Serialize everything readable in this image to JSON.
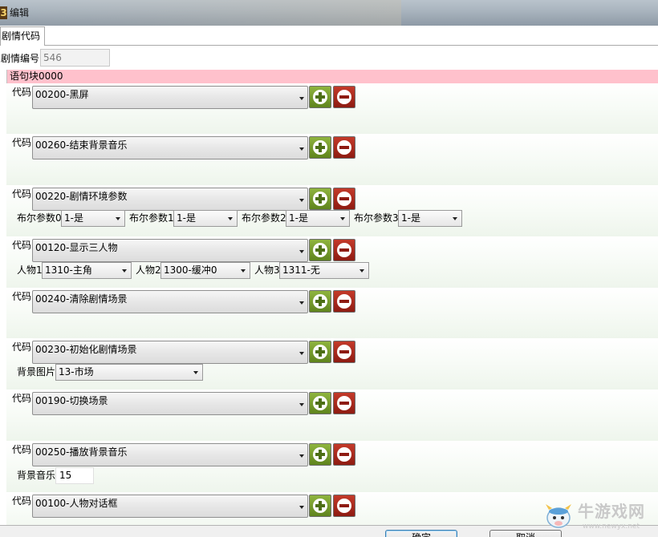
{
  "window": {
    "title": "编辑",
    "icon": "app-logo-icon"
  },
  "tab": {
    "label": "剧情代码"
  },
  "plot_number": {
    "label": "剧情编号",
    "value": "546"
  },
  "block": {
    "title": "语句块0000"
  },
  "rows": [
    {
      "label": "代码",
      "value": "00200-黑屏"
    },
    {
      "label": "代码",
      "value": "00260-结束背景音乐"
    },
    {
      "label": "代码",
      "value": "00220-剧情环境参数",
      "params": [
        {
          "label": "布尔参数0",
          "value": "1-是"
        },
        {
          "label": "布尔参数1",
          "value": "1-是"
        },
        {
          "label": "布尔参数2",
          "value": "1-是"
        },
        {
          "label": "布尔参数3",
          "value": "1-是"
        }
      ]
    },
    {
      "label": "代码",
      "value": "00120-显示三人物",
      "params": [
        {
          "label": "人物1",
          "value": "1310-主角"
        },
        {
          "label": "人物2",
          "value": "1300-缓冲0"
        },
        {
          "label": "人物3",
          "value": "1311-无"
        }
      ]
    },
    {
      "label": "代码",
      "value": "00240-清除剧情场景"
    },
    {
      "label": "代码",
      "value": "00230-初始化剧情场景",
      "params": [
        {
          "label": "背景图片",
          "value": "13-市场"
        }
      ]
    },
    {
      "label": "代码",
      "value": "00190-切换场景"
    },
    {
      "label": "代码",
      "value": "00250-播放背景音乐",
      "params": [
        {
          "label": "背景音乐",
          "value": "15"
        }
      ]
    },
    {
      "label": "代码",
      "value": "00100-人物对话框"
    }
  ],
  "footer": {
    "ok_label": "确定",
    "cancel_label": "取消"
  },
  "watermark": {
    "text": "牛游戏网",
    "url": "www.newyx.net"
  },
  "colors": {
    "block_header": "#ffc1cc",
    "add_button": "#6f9a26",
    "delete_button": "#a5261a"
  }
}
